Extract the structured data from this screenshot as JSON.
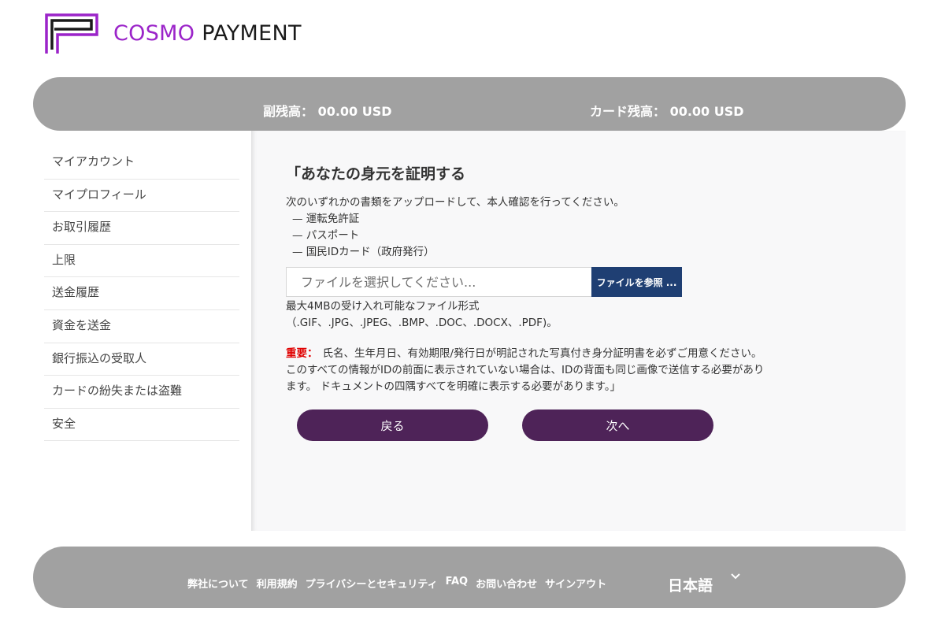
{
  "brand": {
    "name_part1": "COSMO",
    "name_part2": "PAYMENT",
    "accent_color": "#9b24c9"
  },
  "balances": {
    "sub_balance": "副残高： 00.00 USD",
    "card_balance": "カード残高： 00.00 USD"
  },
  "sidebar": {
    "items": [
      {
        "label": "マイアカウント"
      },
      {
        "label": "マイプロフィール"
      },
      {
        "label": "お取引履歴"
      },
      {
        "label": "上限"
      },
      {
        "label": "送金履歴"
      },
      {
        "label": "資金を送金"
      },
      {
        "label": "銀行振込の受取人"
      },
      {
        "label": "カードの紛失または盗難"
      },
      {
        "label": "安全"
      }
    ]
  },
  "main": {
    "title": "「あなたの身元を証明する",
    "intro": "次のいずれかの書類をアップロードして、本人確認を行ってください。",
    "documents": [
      "— 運転免許証",
      "— パスポート",
      "— 国民IDカード（政府発行）"
    ],
    "file_input": {
      "placeholder": "ファイルを選択してください...",
      "value": ""
    },
    "browse_button": "ファイルを参照 ...",
    "format_note_line1": "最大4MBの受け入れ可能なファイル形式",
    "format_note_line2": "（.GIF、.JPG、.JPEG、.BMP、.DOC、.DOCX、.PDF)。",
    "important_label": "重要：",
    "important_text": "氏名、生年月日、有効期限/発行日が明記された写真付き身分証明書を必ずご用意ください。 このすべての情報がIDの前面に表示されていない場合は、IDの背面も同じ画像で送信する必要があります。 ドキュメントの四隅すべてを明確に表示する必要があります。」",
    "back_button": "戻る",
    "next_button": "次へ"
  },
  "footer": {
    "links": [
      {
        "label": "弊社について"
      },
      {
        "label": "利用規約"
      },
      {
        "label": "プライバシーとセキュリティ"
      },
      {
        "label": "FAQ"
      },
      {
        "label": "お問い合わせ"
      },
      {
        "label": "サインアウト"
      }
    ],
    "language": "日本語",
    "language_icon": "chevron-down-icon"
  },
  "colors": {
    "bar_gray": "#a1a1a1",
    "button_purple": "#4e2358",
    "browse_blue": "#1f3f73",
    "important_red": "#e00000"
  }
}
